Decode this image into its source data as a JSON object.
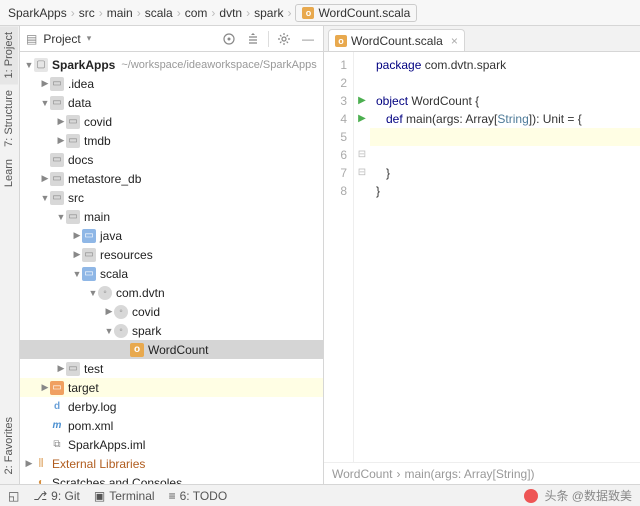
{
  "breadcrumbs": [
    "SparkApps",
    "src",
    "main",
    "scala",
    "com",
    "dvtn",
    "spark"
  ],
  "breadcrumb_file": "WordCount.scala",
  "project_tool": {
    "title": "Project"
  },
  "side_tabs": {
    "project": "1: Project",
    "structure": "7: Structure",
    "learn": "Learn",
    "favorites": "2: Favorites"
  },
  "tree": {
    "root": {
      "name": "SparkApps",
      "path": "~/workspace/ideaworkspace/SparkApps"
    },
    "idea": ".idea",
    "data": "data",
    "covid": "covid",
    "tmdb": "tmdb",
    "docs": "docs",
    "metastore": "metastore_db",
    "src": "src",
    "mainDir": "main",
    "java": "java",
    "resources": "resources",
    "scala": "scala",
    "pkg": "com.dvtn",
    "pkg_covid": "covid",
    "pkg_spark": "spark",
    "wordcount": "WordCount",
    "test": "test",
    "target": "target",
    "derby": "derby.log",
    "pom": "pom.xml",
    "iml": "SparkApps.iml",
    "extlib": "External Libraries",
    "scratches": "Scratches and Consoles"
  },
  "editor": {
    "tab_label": "WordCount.scala",
    "gutter": [
      "1",
      "2",
      "3",
      "4",
      "5",
      "6",
      "7",
      "8"
    ],
    "l1_a": "package",
    "l1_b": " com.dvtn.spark",
    "l3_a": "object",
    "l3_b": " WordCount {",
    "l4_a": "   def",
    "l4_b": " main(args: Array[",
    "l4_str": "String",
    "l4_c": "]): Unit = {",
    "l6": "   }",
    "l7": "}",
    "nav_a": "WordCount",
    "nav_b": "main(args: Array[String])"
  },
  "status": {
    "git": "9: Git",
    "terminal": "Terminal",
    "todo": "6: TODO"
  },
  "watermark": "头条 @数据致美"
}
